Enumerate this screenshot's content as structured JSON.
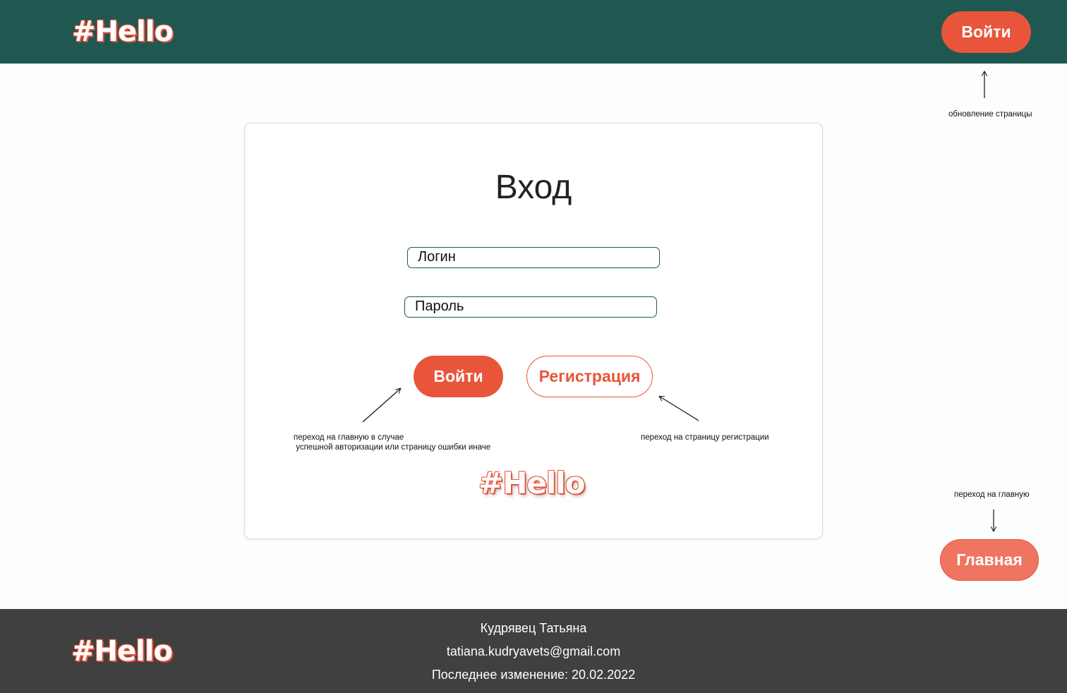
{
  "header": {
    "logo": "#Hello",
    "login_button": "Войти"
  },
  "annotations": {
    "refresh": "обновление страницы",
    "login_result": "переход на главную в случае\n успешной авторизации или страницу ошибки иначе",
    "register": "переход на страницу регистрации",
    "to_main": "переход на главную"
  },
  "card": {
    "title": "Вход",
    "login_placeholder": "Логин",
    "password_placeholder": "Пароль",
    "login_button": "Войти",
    "register_button": "Регистрация",
    "logo": "#Hello"
  },
  "main_button": "Главная",
  "footer": {
    "logo": "#Hello",
    "author": "Кудрявец Татьяна",
    "email": "tatiana.kudryavets@gmail.com",
    "last_modified": "Последнее изменение: 20.02.2022"
  },
  "colors": {
    "header_bg": "#1f5751",
    "accent": "#e8553a",
    "main_button_bg": "#ef7561",
    "footer_bg": "#404040"
  },
  "icons": [
    "arrow-up-icon",
    "arrow-down-icon",
    "arrow-diagonal-icon"
  ]
}
